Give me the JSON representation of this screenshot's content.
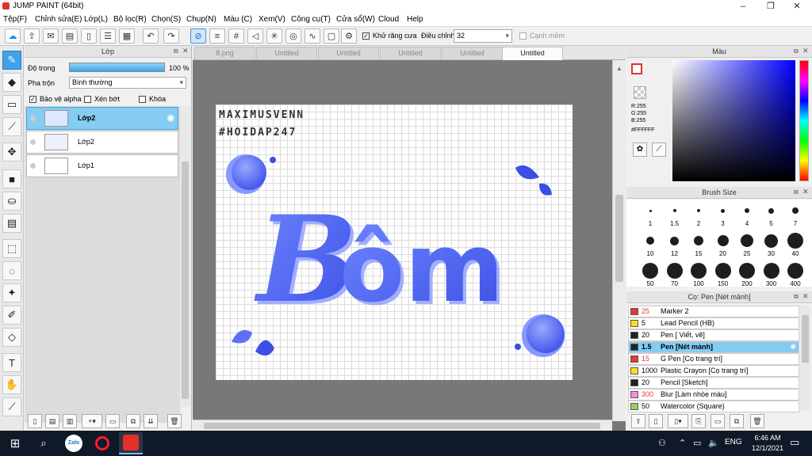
{
  "window": {
    "title": "JUMP PAINT (64bit)",
    "minimize": "–",
    "maximize": "❐",
    "close": "✕"
  },
  "menu": [
    "Tệp(F)",
    "Chỉnh sửa(E)",
    "Lớp(L)",
    "Bộ lọc(R)",
    "Chọn(S)",
    "Chụp(N)",
    "Màu (C)",
    "Xem(V)",
    "Công cụ(T)",
    "Cửa sổ(W)",
    "Cloud",
    "Help"
  ],
  "toolbar": {
    "antialias_label": "Khử răng cưa",
    "adjust_label": "Điều chỉnh",
    "adjust_value": "32",
    "smooth_label": "Cạnh mềm"
  },
  "layer_panel": {
    "title": "Lớp",
    "opacity_label": "Độ trong",
    "opacity_value": "100 %",
    "opacity_fraction": 1.0,
    "blend_label": "Pha trộn",
    "blend_value": "Bình thường",
    "protect_alpha": "Bảo vệ alpha",
    "clip": "Xén bớt",
    "lock": "Khóa",
    "layers": [
      {
        "name": "Lớp2"
      },
      {
        "name": "Lớp2"
      },
      {
        "name": "Lớp1"
      }
    ]
  },
  "tabs": [
    "8.png",
    "Untitled",
    "Untitled",
    "Untitled",
    "Untitled",
    "Untitled"
  ],
  "artwork": {
    "sig1": "MAXIMUSVENN",
    "sig2": "#HOIDAP247",
    "word": "Bôm"
  },
  "color_panel": {
    "title": "Màu",
    "r": "R:255",
    "g": "G:255",
    "b": "B:255",
    "hex": "#FFFFFF",
    "hue_color": "#0000ff"
  },
  "brush_size_panel": {
    "title": "Brush Size",
    "row1": [
      "1",
      "1.5",
      "2",
      "3",
      "4",
      "5",
      "7"
    ],
    "row2": [
      "10",
      "12",
      "15",
      "20",
      "25",
      "30",
      "40"
    ],
    "row3": [
      "50",
      "70",
      "100",
      "150",
      "200",
      "300",
      "400"
    ]
  },
  "brush_panel": {
    "title": "Cọ: Pen [Nét mảnh]",
    "items": [
      {
        "size": "25",
        "name": "Marker 2",
        "color": "#e53935"
      },
      {
        "size": "5",
        "name": "Lead Pencil (HB)",
        "color": "#f4e020"
      },
      {
        "size": "20",
        "name": "Pen [ Viết, vẽ]",
        "color": "#222222"
      },
      {
        "size": "1.5",
        "name": "Pen [Nét mảnh]",
        "color": "#222222"
      },
      {
        "size": "15",
        "name": "G Pen [Cọ trang trí]",
        "color": "#e53935"
      },
      {
        "size": "1000",
        "name": "Plastic Crayon [Cọ trang trí]",
        "color": "#f4e020"
      },
      {
        "size": "20",
        "name": "Pencil [Sketch]",
        "color": "#222222"
      },
      {
        "size": "300",
        "name": "Blur [Làm nhòe màu]",
        "color": "#f48fe0"
      },
      {
        "size": "50",
        "name": "Watercolor (Square)",
        "color": "#9ccc65"
      }
    ]
  },
  "taskbar": {
    "time": "6:46 AM",
    "date": "12/1/2021",
    "lang": "ENG"
  }
}
